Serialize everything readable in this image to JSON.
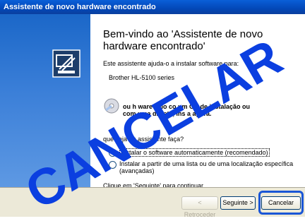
{
  "window": {
    "title": "Assistente de novo hardware encontrado"
  },
  "left_panel": {
    "icon": "hardware-wizard-icon"
  },
  "content": {
    "heading": "Bem-vindo ao 'Assistente de novo hardware encontrado'",
    "intro": "Este assistente ajuda-o a instalar software para:",
    "device": "Brother HL-5100 series",
    "cd_text_line1": "ou h  ware veio co   um CD de instalação ou",
    "cd_text_line2": "com uma dis  ete, ins   a agora.",
    "question": "que   seja qu   assistente faça?",
    "options": [
      {
        "label": "Instalar o software automaticamente (recomendado)",
        "selected": true
      },
      {
        "label": "Instalar a partir de uma lista ou de uma localização específica",
        "label2": "(avançadas)",
        "selected": false
      }
    ],
    "footer": "Clique em 'Seguinte' para continuar."
  },
  "buttons": {
    "back": "< Retroceder",
    "next": "Seguinte >",
    "cancel": "Cancelar"
  },
  "watermark": {
    "text": "CANCELAR",
    "color": "#0b3fe0"
  }
}
